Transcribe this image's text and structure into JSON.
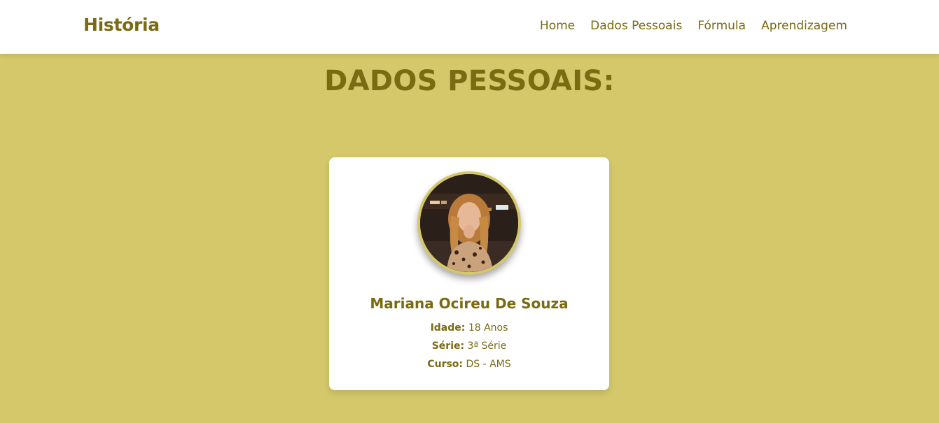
{
  "header": {
    "brand": "História",
    "nav": [
      "Home",
      "Dados Pessoais",
      "Fórmula",
      "Aprendizagem"
    ]
  },
  "section": {
    "title": "DADOS PESSOAIS:"
  },
  "profile": {
    "name": "Mariana Ocireu De Souza",
    "fields": [
      {
        "label": "Idade:",
        "value": "18 Anos"
      },
      {
        "label": "Série:",
        "value": "3ª Série"
      },
      {
        "label": "Curso:",
        "value": "DS - AMS"
      }
    ]
  },
  "colors": {
    "background": "#d4c86a",
    "accent_text": "#7a6a12",
    "card": "#ffffff"
  }
}
